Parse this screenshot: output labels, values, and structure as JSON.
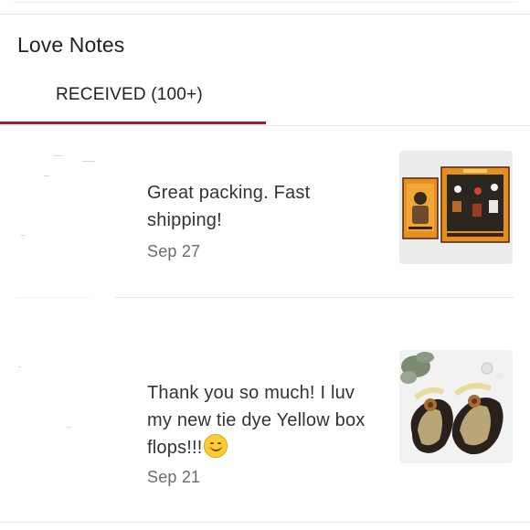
{
  "page": {
    "title": "Love Notes"
  },
  "tabs": [
    {
      "label": "RECEIVED (100+)",
      "active": true
    }
  ],
  "notes": [
    {
      "message": "Great packing. Fast shipping!",
      "date": "Sep 27",
      "photo_icon": "boxed-ornaments-photo"
    },
    {
      "message": "Thank you so much! I luv my new tie dye Yellow box flops!!!",
      "emoji": "smiling-face-emoji",
      "date": "Sep 21",
      "photo_icon": "flip-flops-photo"
    }
  ],
  "colors": {
    "accent": "#a01c2c",
    "text": "#222222",
    "muted": "#6b6b6b",
    "divider": "#e6e6e6"
  }
}
